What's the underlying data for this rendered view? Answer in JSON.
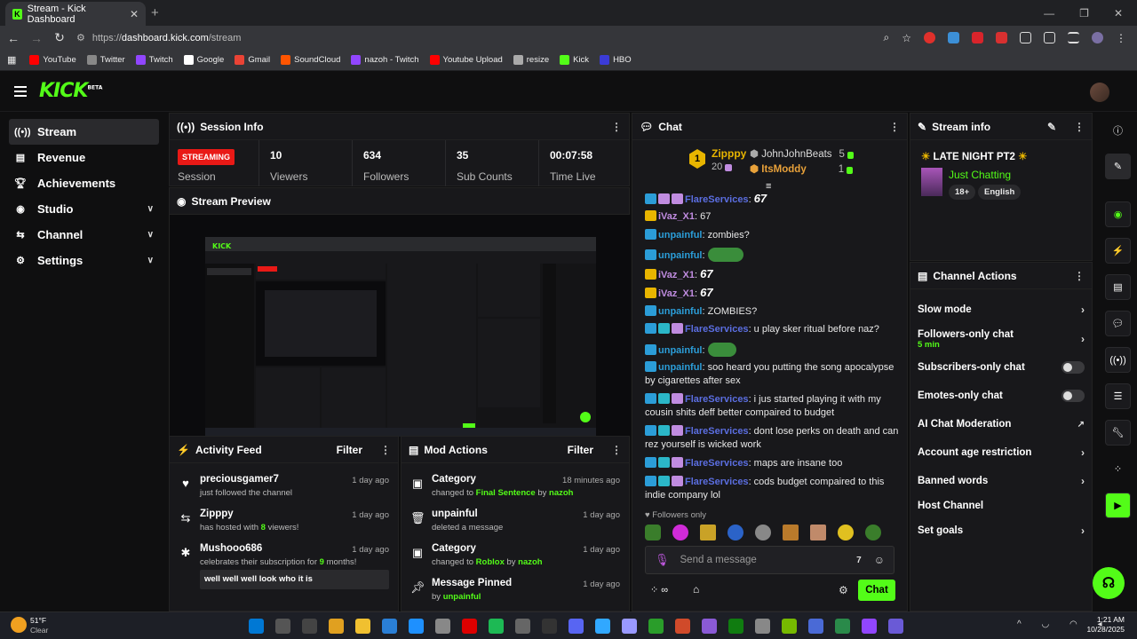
{
  "browser": {
    "tab_title": "Stream - Kick Dashboard",
    "url_prefix": "https://",
    "url_host": "dashboard.kick.com",
    "url_path": "/stream"
  },
  "bookmarks": [
    {
      "label": "YouTube",
      "color": "#ff0000"
    },
    {
      "label": "Twitter",
      "color": "#888888"
    },
    {
      "label": "Twitch",
      "color": "#9146ff"
    },
    {
      "label": "Google",
      "color": "#ffffff"
    },
    {
      "label": "Gmail",
      "color": "#ea4335"
    },
    {
      "label": "SoundCloud",
      "color": "#ff5500"
    },
    {
      "label": "nazoh - Twitch",
      "color": "#9146ff"
    },
    {
      "label": "Youtube Upload",
      "color": "#ff0000"
    },
    {
      "label": "resize",
      "color": "#aaaaaa"
    },
    {
      "label": "Kick",
      "color": "#53fc18"
    },
    {
      "label": "HBO",
      "color": "#3b3bd6"
    }
  ],
  "header": {
    "logo": "KICK",
    "logo_sup": "BETA"
  },
  "nav": {
    "items": [
      {
        "label": "Stream",
        "icon": "stream-icon"
      },
      {
        "label": "Revenue",
        "icon": "revenue-icon"
      },
      {
        "label": "Achievements",
        "icon": "trophy-icon"
      },
      {
        "label": "Studio",
        "icon": "studio-icon"
      },
      {
        "label": "Channel",
        "icon": "channel-icon"
      },
      {
        "label": "Settings",
        "icon": "gear-icon"
      }
    ]
  },
  "session": {
    "title": "Session Info",
    "status": "STREAMING",
    "status_label": "Session",
    "viewers": "10",
    "viewers_label": "Viewers",
    "followers": "634",
    "followers_label": "Followers",
    "subs": "35",
    "subs_label": "Sub Counts",
    "time": "00:07:58",
    "time_label": "Time Live"
  },
  "preview": {
    "title": "Stream Preview"
  },
  "activity": {
    "title": "Activity Feed",
    "filter": "Filter",
    "items": [
      {
        "name": "preciousgamer7",
        "desc": "just followed the channel",
        "date": "1 day ago"
      },
      {
        "name": "Zipppy",
        "desc_a": "has hosted with ",
        "desc_n": "8",
        "desc_b": " viewers!",
        "date": "1 day ago"
      },
      {
        "name": "Mushooo686",
        "desc_a": "celebrates their subscription for ",
        "desc_n": "9",
        "desc_b": " months!",
        "date": "1 day ago",
        "quote": "well well well look who it is"
      }
    ]
  },
  "mod": {
    "title": "Mod Actions",
    "filter": "Filter",
    "items": [
      {
        "title": "Category",
        "pre": "changed to ",
        "hl": "Final Sentence",
        "mid": " by ",
        "by": "nazoh",
        "date": "18 minutes ago"
      },
      {
        "title": "unpainful",
        "pre": "deleted a message",
        "date": "1 day ago"
      },
      {
        "title": "Category",
        "pre": "changed to ",
        "hl": "Roblox",
        "mid": " by ",
        "by": "nazoh",
        "date": "1 day ago"
      },
      {
        "title": "Message Pinned",
        "pre": "by ",
        "by": "unpainful",
        "date": "1 day ago"
      }
    ]
  },
  "chat": {
    "title": "Chat",
    "top1": "Zipppy",
    "top1_count": "20",
    "top2": "JohnJohnBeats",
    "top2_count": "5",
    "top3": "ItsModdy",
    "top3_count": "1",
    "rank": "1",
    "followers_only": "Followers only",
    "placeholder": "Send a message",
    "send": "Chat"
  },
  "chat_messages": [
    {
      "user": "FlareServices",
      "color": "#5b6ee1",
      "text": ": ",
      "emote": "67",
      "badges": "b1 b2 b2"
    },
    {
      "user": "iVaz_X1",
      "color": "#c08ce0",
      "text": ": 67",
      "badges": "b3"
    },
    {
      "user": "unpainful",
      "color": "#2b9dd8",
      "text": ": zombies?",
      "badges": "b1"
    },
    {
      "user": "unpainful",
      "color": "#2b9dd8",
      "text": ": ",
      "badges": "b1"
    },
    {
      "user": "iVaz_X1",
      "color": "#c08ce0",
      "text": ": ",
      "emote": "67",
      "badges": "b3"
    },
    {
      "user": "iVaz_X1",
      "color": "#c08ce0",
      "text": ": ",
      "emote": "67",
      "badges": "b3"
    },
    {
      "user": "unpainful",
      "color": "#2b9dd8",
      "text": ": ZOMBIES?",
      "badges": "b1"
    },
    {
      "user": "FlareServices",
      "color": "#5b6ee1",
      "text": ": u play sker ritual before naz?",
      "badges": "b1 b4 b2"
    },
    {
      "user": "unpainful",
      "color": "#2b9dd8",
      "text": ": ",
      "badges": "b1"
    },
    {
      "user": "unpainful",
      "color": "#2b9dd8",
      "text": ": soo heard you putting the song apocalypse by cigarettes after sex",
      "badges": "b1"
    },
    {
      "user": "FlareServices",
      "color": "#5b6ee1",
      "text": ": i jus started playing it with my cousin shits deff better compaired to budget",
      "badges": "b1 b4 b2"
    },
    {
      "user": "FlareServices",
      "color": "#5b6ee1",
      "text": ": dont lose perks on death and can rez yourself is wicked work",
      "badges": "b1 b4 b2"
    },
    {
      "user": "FlareServices",
      "color": "#5b6ee1",
      "text": ": maps are insane too",
      "badges": "b1 b4 b2"
    },
    {
      "user": "FlareServices",
      "color": "#5b6ee1",
      "text": ": cods budget compaired to this indie company lol",
      "badges": "b1 b4 b2"
    }
  ],
  "stream_info": {
    "title": "Stream info",
    "stream_title": "LATE NIGHT PT2",
    "category": "Just Chatting",
    "tag1": "18+",
    "tag2": "English"
  },
  "channel_actions": {
    "title": "Channel Actions",
    "rows": [
      {
        "label": "Slow mode",
        "type": "chev"
      },
      {
        "label": "Followers-only chat",
        "sub": "5 min",
        "type": "chev"
      },
      {
        "label": "Subscribers-only chat",
        "type": "toggle"
      },
      {
        "label": "Emotes-only chat",
        "type": "toggle"
      },
      {
        "label": "AI Chat Moderation",
        "type": "ext"
      },
      {
        "label": "Account age restriction",
        "type": "chev"
      },
      {
        "label": "Banned words",
        "type": "chev"
      },
      {
        "label": "Host Channel",
        "type": "none"
      },
      {
        "label": "Set goals",
        "type": "chev"
      }
    ]
  },
  "taskbar": {
    "temp": "51°F",
    "weather": "Clear",
    "time": "1:21 AM",
    "date": "10/28/2025"
  }
}
